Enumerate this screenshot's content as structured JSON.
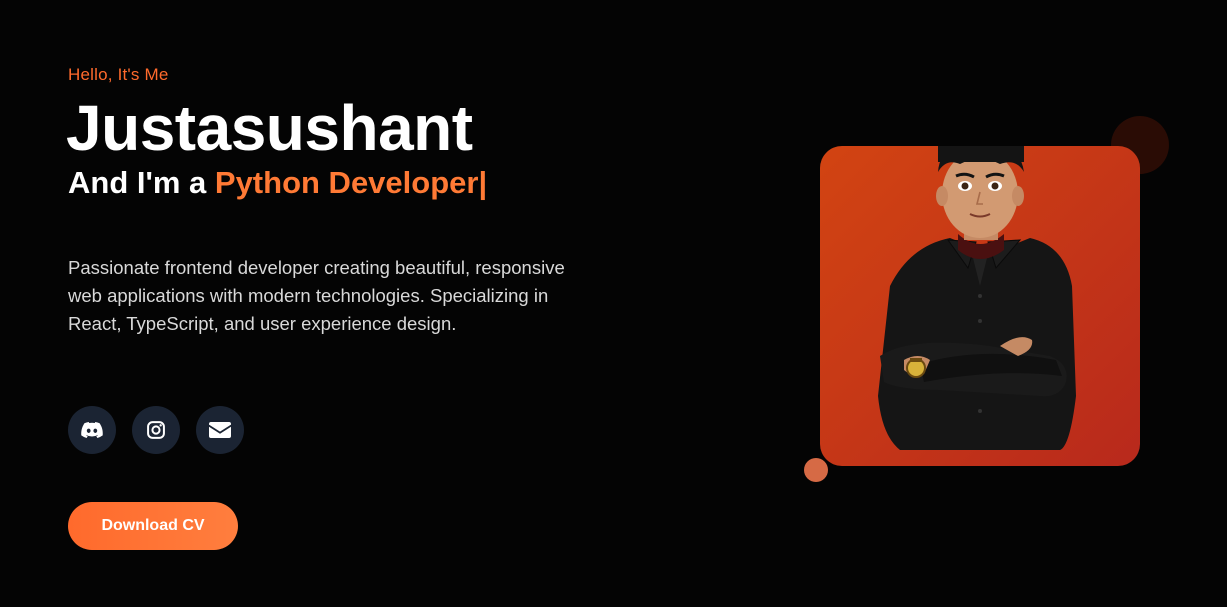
{
  "hero": {
    "greeting": "Hello, It's Me",
    "name": "Justasushant",
    "role_prefix": "And I'm a ",
    "role": "Python Developer",
    "cursor": "|",
    "bio": "Passionate frontend developer creating beautiful, responsive web applications with modern technologies. Specializing in React, TypeScript, and user experience design."
  },
  "socials": [
    {
      "name": "Discord",
      "icon": "discord-icon"
    },
    {
      "name": "Instagram",
      "icon": "instagram-icon"
    },
    {
      "name": "Email",
      "icon": "envelope-icon"
    }
  ],
  "actions": {
    "download_label": "Download CV"
  },
  "colors": {
    "accent": "#ff6a2c",
    "background": "#040404",
    "social_bg": "#1b2433",
    "card_gradient_start": "#d24412",
    "card_gradient_end": "#b8291c"
  }
}
